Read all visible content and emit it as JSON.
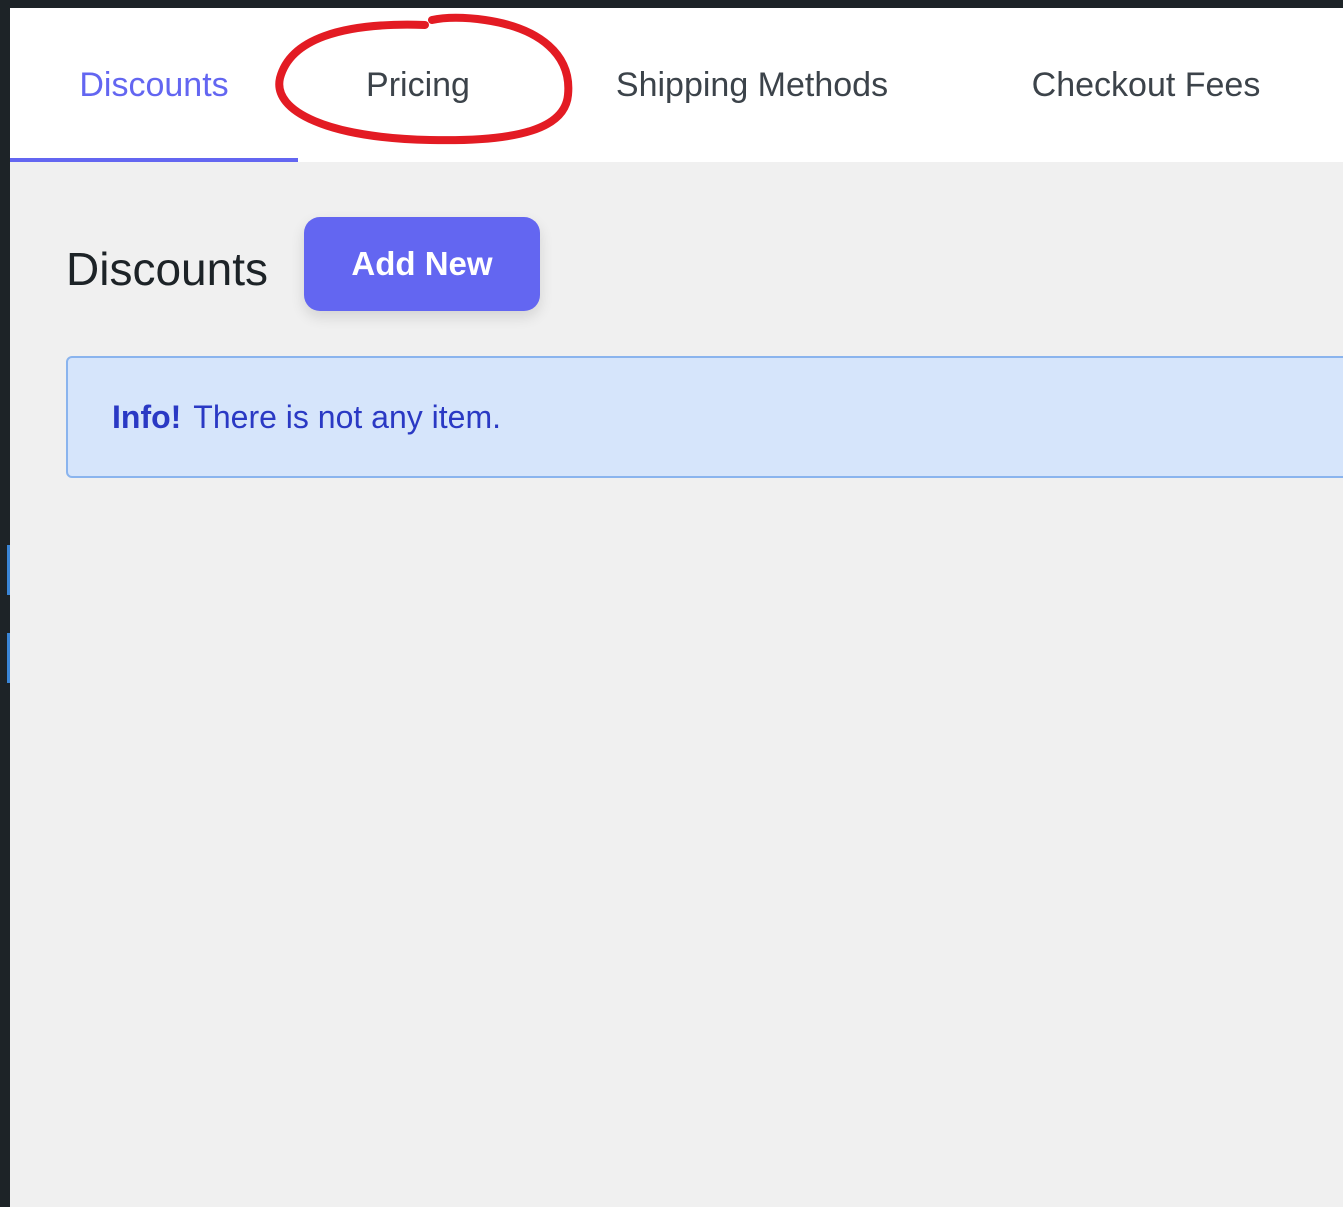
{
  "tabs": [
    {
      "label": "Discounts",
      "active": true
    },
    {
      "label": "Pricing",
      "active": false
    },
    {
      "label": "Shipping Methods",
      "active": false
    },
    {
      "label": "Checkout Fees",
      "active": false
    }
  ],
  "page": {
    "heading": "Discounts",
    "add_new_label": "Add New"
  },
  "notice": {
    "strong": "Info!",
    "message": "There is not any item."
  },
  "colors": {
    "accent": "#6366f1",
    "annotation": "#e31b23",
    "notice_bg": "#d6e5fb",
    "notice_text": "#2a39c4"
  }
}
